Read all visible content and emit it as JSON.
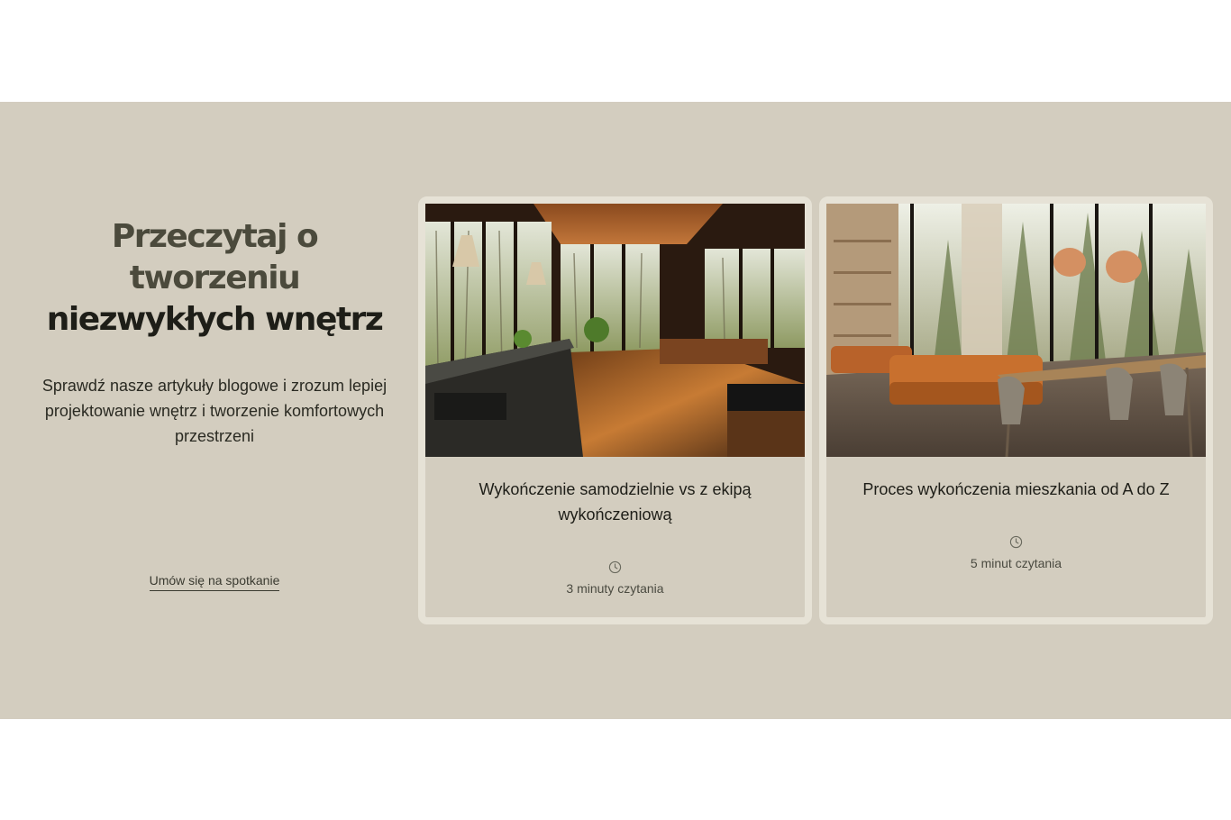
{
  "section": {
    "heading_line1": "Przeczytaj o tworzeniu",
    "heading_line2": "niezwykłych wnętrz",
    "description": "Sprawdź nasze artykuły blogowe i zrozum lepiej projektowanie wnętrz i tworzenie komfortowych przestrzeni",
    "cta_label": "Umów się na spotkanie"
  },
  "articles": [
    {
      "title": "Wykończenie samodzielnie vs z ekipą wykończeniową",
      "read_time": "3 minuty czytania",
      "image": "kitchen-forest-photo"
    },
    {
      "title": "Proces wykończenia mieszkania od A do Z",
      "read_time": "5 minut czytania",
      "image": "living-room-forest-photo"
    }
  ],
  "colors": {
    "band": "#d3cdbf",
    "card_border": "#e6e2d6",
    "text": "#1e1e18"
  }
}
